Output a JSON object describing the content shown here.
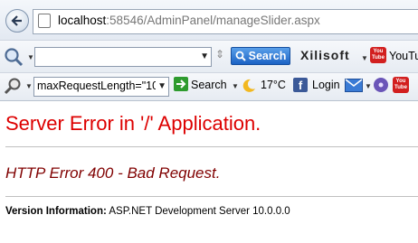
{
  "browser": {
    "url_host": "localhost",
    "url_rest": ":58546/AdminPanel/manageSlider.aspx"
  },
  "toolbar1": {
    "search_input_value": "",
    "search_button_label": "Search",
    "brand_label": "Xilisoft",
    "youtube_label": "YouTu",
    "youtube_logo_top": "You",
    "youtube_logo_bottom": "Tube"
  },
  "toolbar2": {
    "select_value": "maxRequestLength=\"10",
    "search_label": "Search",
    "weather_label": "17°C",
    "facebook_label": "Login",
    "youtube_logo_top": "You",
    "youtube_logo_bottom": "Tube",
    "colors": {
      "facebook": "#3b5998",
      "youtube": "#d21f1f",
      "search_arrow": "#2e9b2e"
    }
  },
  "page": {
    "title": "Server Error in '/' Application.",
    "subtitle": "HTTP Error 400 - Bad Request.",
    "version_label": "Version Information:",
    "version_value": " ASP.NET Development Server 10.0.0.0",
    "colors": {
      "title": "#dd0000",
      "subtitle": "#800000"
    }
  }
}
